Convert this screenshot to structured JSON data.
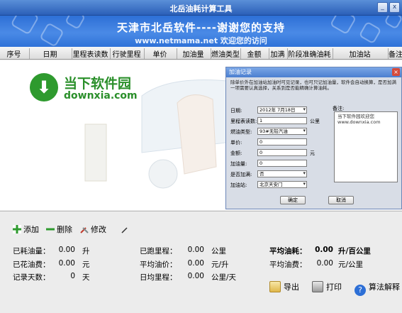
{
  "window": {
    "title": "北岳油耗计算工具",
    "minimize": "_",
    "close": "x"
  },
  "banner": {
    "headline": "天津市北岳软件----谢谢您的支持",
    "subline": "www.netmama.net 欢迎您的访问"
  },
  "columns": [
    "序号",
    "日期",
    "里程表读数",
    "行驶里程",
    "单价",
    "加油量",
    "燃油类型",
    "金额",
    "加满",
    "阶段准确油耗",
    "加油站",
    "备注"
  ],
  "watermark": {
    "cn": "当下软件园",
    "en": "downxia.com"
  },
  "dialog": {
    "title": "加油记录",
    "note": "除单价外在加油站加油时可见记录，也可只记加油量，软件会自动换算，是否加满一项需要认真选择，关系到是否能精确计算油耗。",
    "fields": [
      {
        "label": "日期:",
        "value": "2012年 7月18日",
        "unit": "",
        "select": true
      },
      {
        "label": "里程表读数:",
        "value": "1",
        "unit": "公里",
        "select": false
      },
      {
        "label": "燃油类型:",
        "value": "93#无铅汽油",
        "unit": "",
        "select": true
      },
      {
        "label": "单价:",
        "value": "0",
        "unit": "",
        "select": false
      },
      {
        "label": "金额:",
        "value": "0",
        "unit": "元",
        "select": false
      },
      {
        "label": "加油量:",
        "value": "0",
        "unit": "",
        "select": false
      },
      {
        "label": "是否加满:",
        "value": "否",
        "unit": "",
        "select": true
      },
      {
        "label": "加油站:",
        "value": "北京天安门",
        "unit": "",
        "select": true
      }
    ],
    "remark_label": "备注:",
    "remark_value": "当下软件园欢迎您 www.downxia.com",
    "ok": "确定",
    "cancel": "取消"
  },
  "toolbar": {
    "add": "添加",
    "delete": "删除",
    "edit": "修改"
  },
  "stats": {
    "consumed_fuel": {
      "label": "已耗油量：",
      "value": "0.00",
      "unit": "升"
    },
    "spent_fuel": {
      "label": "已花油费：",
      "value": "0.00",
      "unit": "元"
    },
    "record_days": {
      "label": "记录天数：",
      "value": "0",
      "unit": "天"
    },
    "distance": {
      "label": "已跑里程：",
      "value": "0.00",
      "unit": "公里"
    },
    "avg_price": {
      "label": "平均油价：",
      "value": "0.00",
      "unit": "元/升"
    },
    "daily_distance": {
      "label": "日均里程：",
      "value": "0.00",
      "unit": "公里/天"
    },
    "avg_consumption": {
      "label": "平均油耗：",
      "value": "0.00",
      "unit": "升/百公里"
    },
    "avg_cost": {
      "label": "平均油费：",
      "value": "0.00",
      "unit": "元/公里"
    }
  },
  "actions": {
    "export": "导出",
    "print": "打印",
    "explain": "算法解释"
  },
  "colors": {
    "accent": "#2d6fd6",
    "logo_green": "#2e9a2e"
  }
}
